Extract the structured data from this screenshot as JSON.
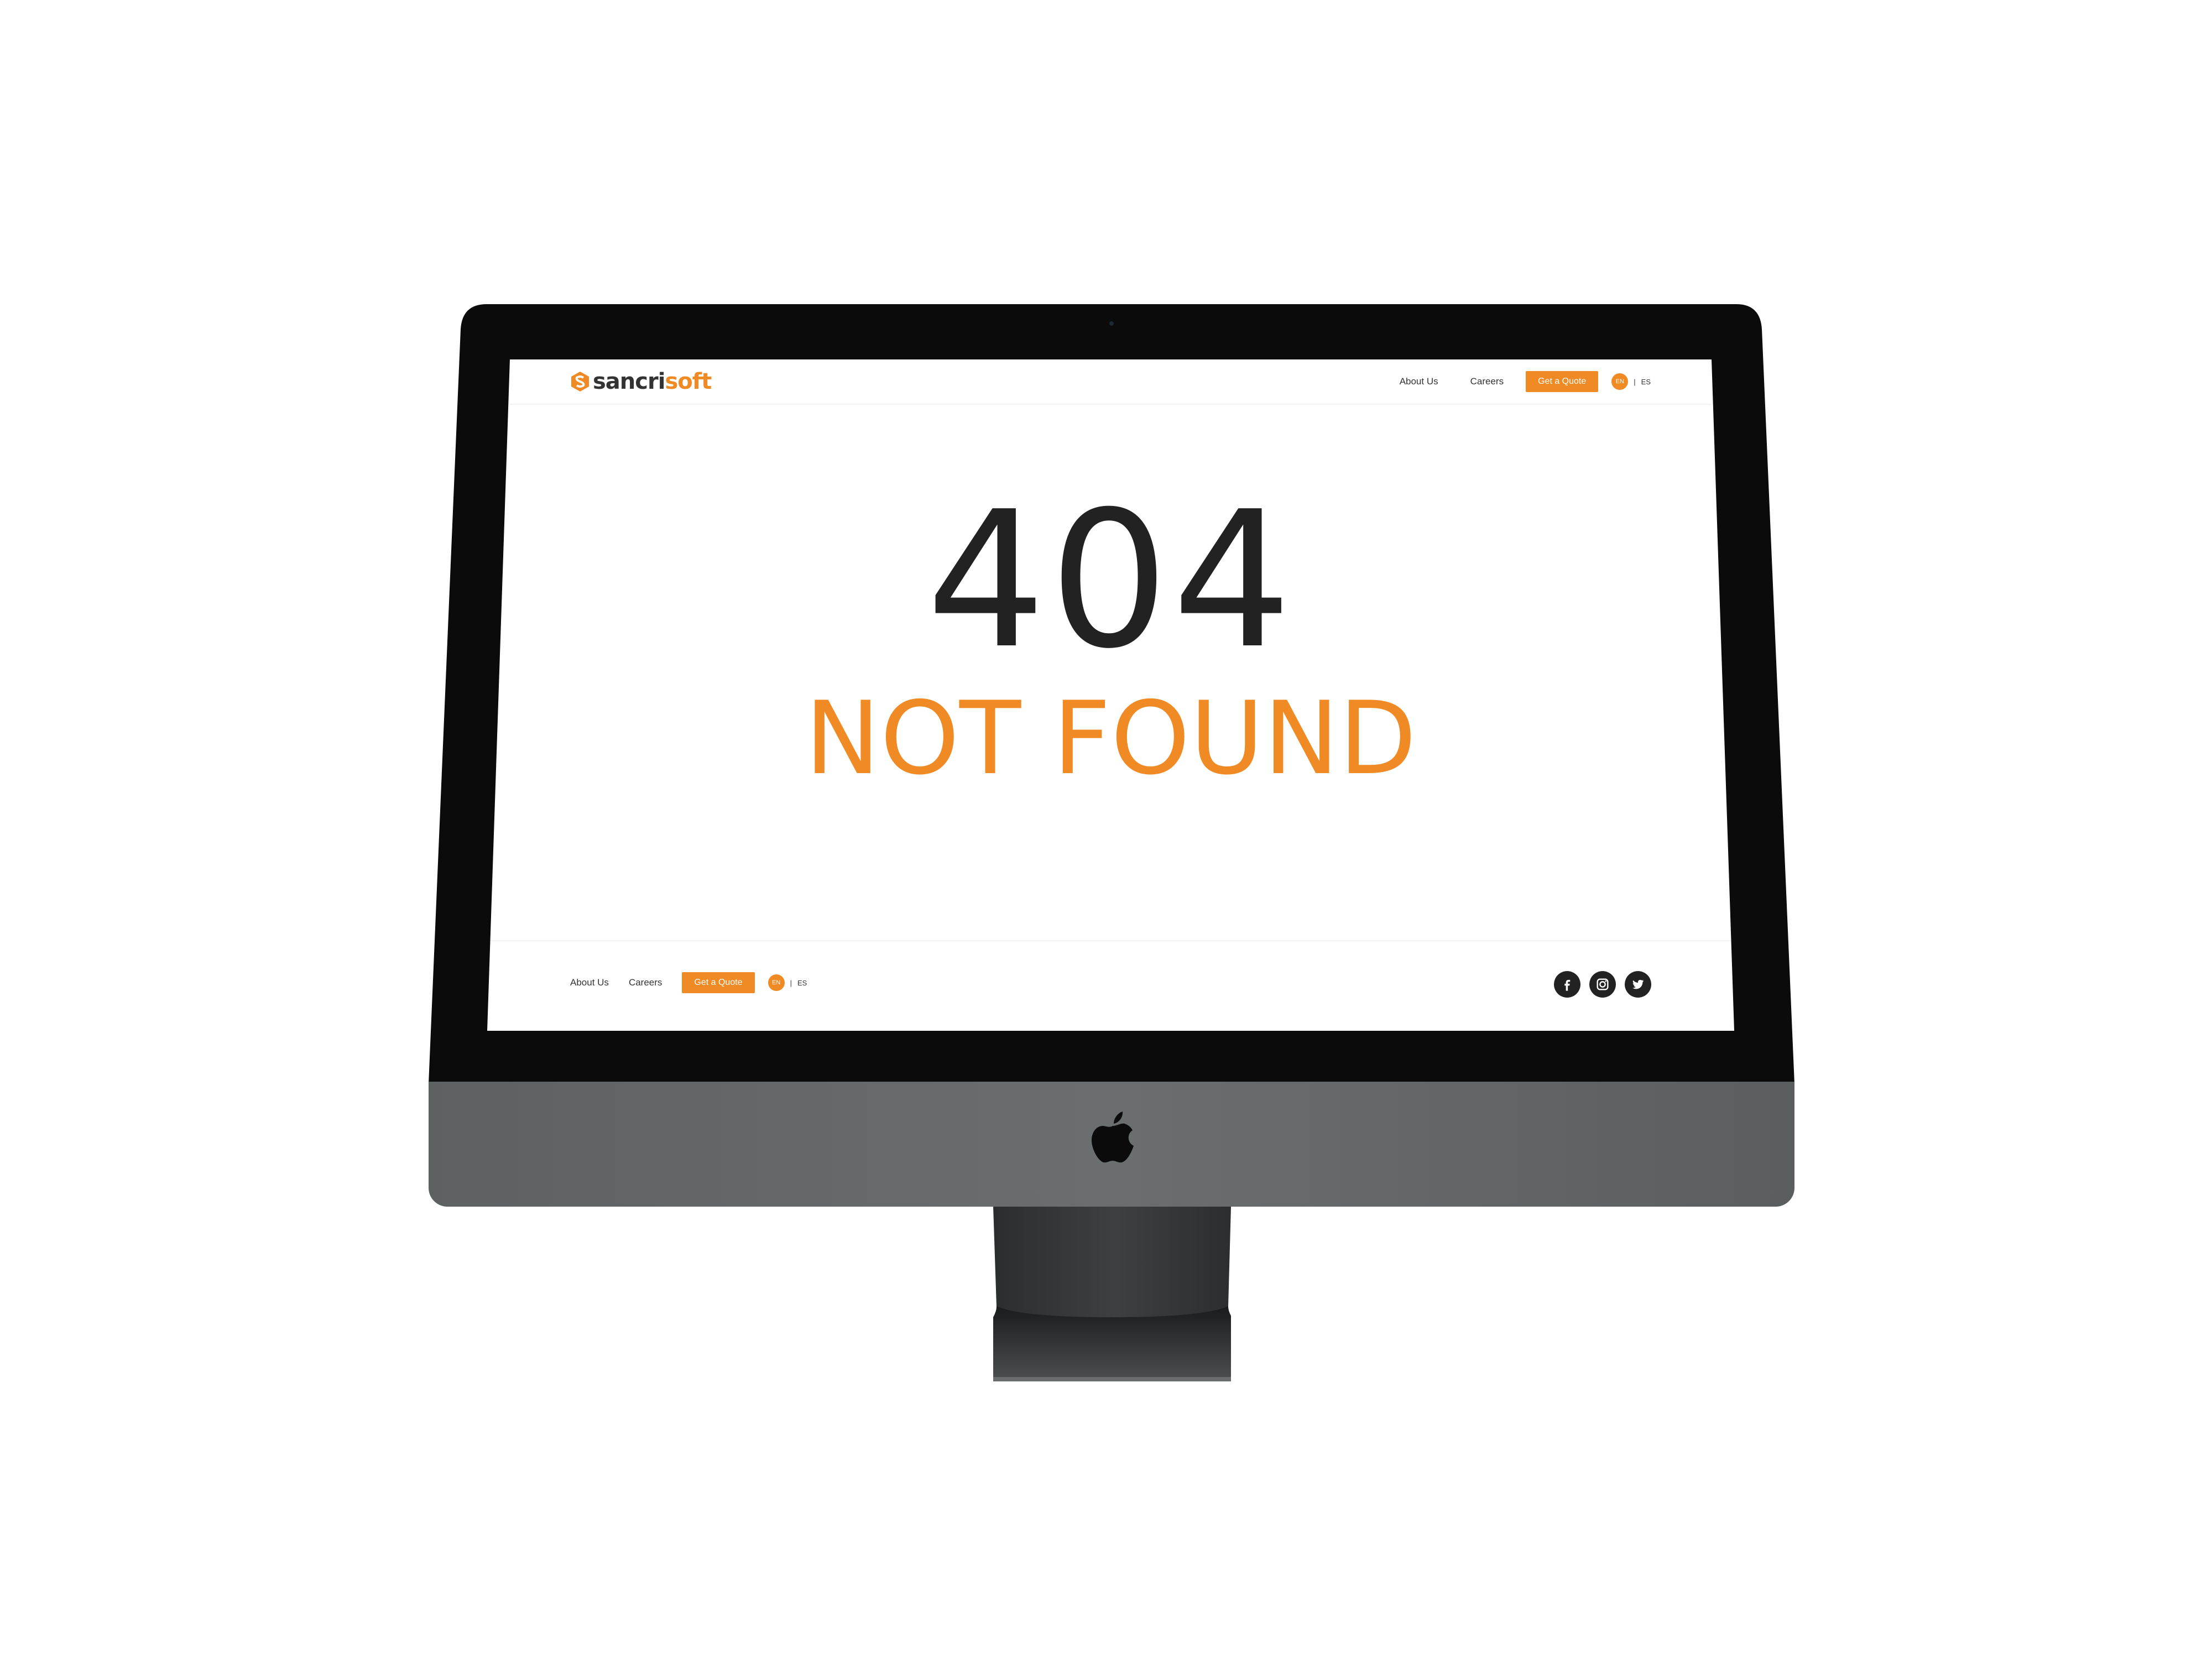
{
  "site": {
    "brand": {
      "part1": "sancri",
      "part2": "soft",
      "color": "#f08a24"
    },
    "header": {
      "nav": [
        "About Us",
        "Careers"
      ],
      "cta": "Get a Quote",
      "lang": {
        "current": "EN",
        "separator": "|",
        "other": "ES"
      }
    },
    "error": {
      "code": "404",
      "message": "NOT FOUND"
    },
    "footer": {
      "nav": [
        "About Us",
        "Careers"
      ],
      "cta": "Get a Quote",
      "lang": {
        "current": "EN",
        "separator": "|",
        "other": "ES"
      },
      "social": [
        "facebook-icon",
        "instagram-icon",
        "twitter-icon"
      ]
    }
  },
  "device": {
    "logo": "apple-icon"
  }
}
